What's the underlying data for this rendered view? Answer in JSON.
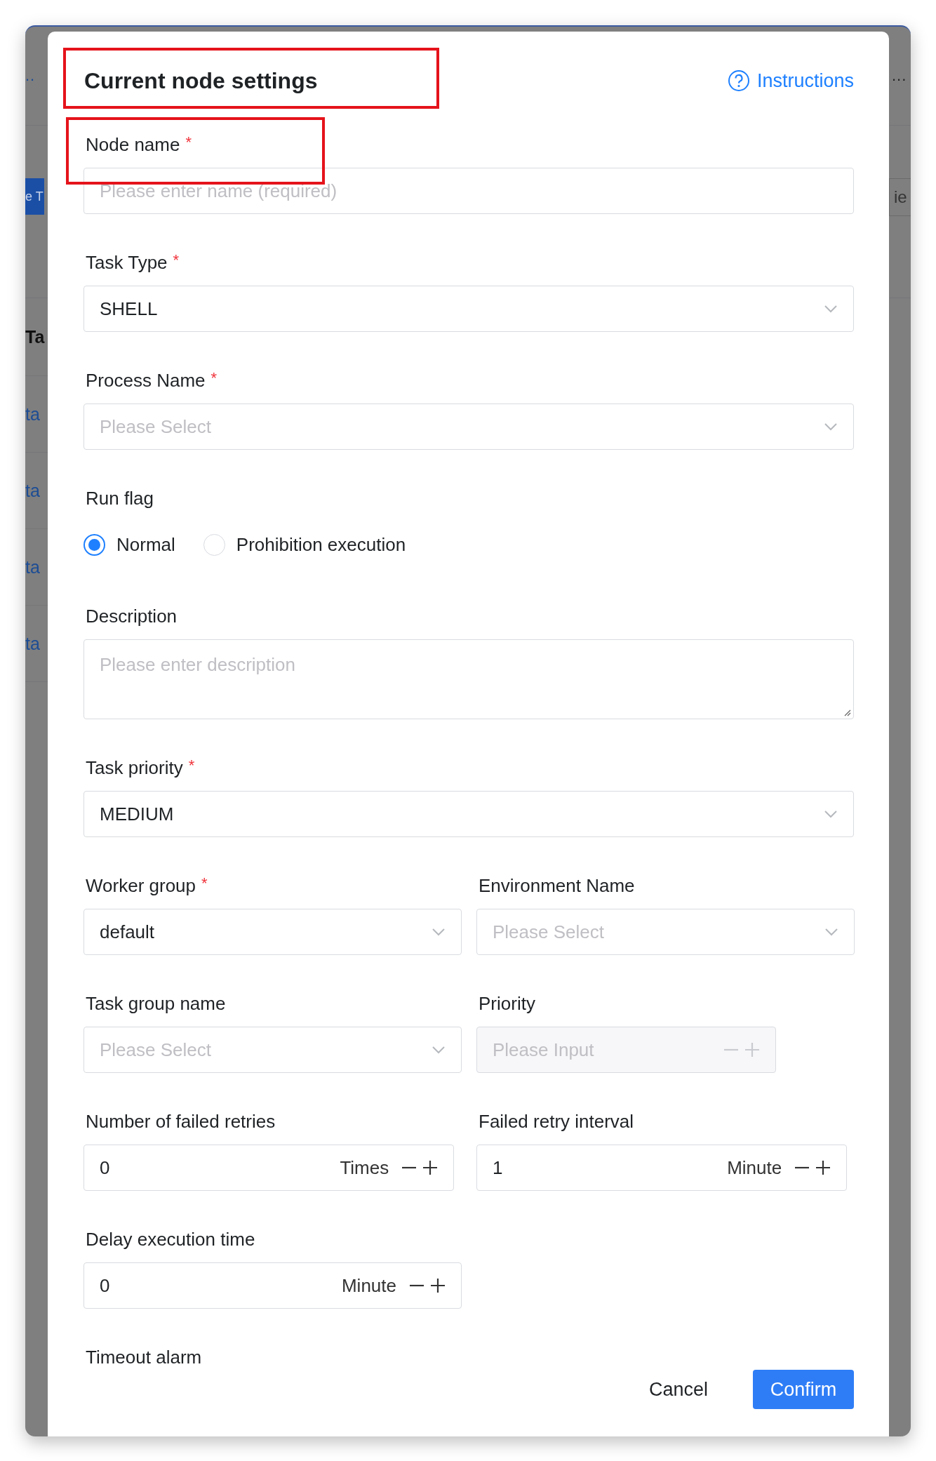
{
  "backdrop": {
    "left": [
      {
        "kind": "dots",
        "text": ".."
      },
      {
        "kind": "button",
        "text": "e T"
      },
      {
        "kind": "header",
        "text": "Ta"
      },
      {
        "kind": "link",
        "text": "ta"
      },
      {
        "kind": "link",
        "text": "ta"
      },
      {
        "kind": "link",
        "text": "ta"
      },
      {
        "kind": "link",
        "text": "ta"
      }
    ],
    "right": [
      {
        "kind": "dots",
        "text": "..."
      },
      {
        "kind": "field",
        "text": "ie"
      }
    ]
  },
  "modal": {
    "title": "Current node settings",
    "help_link": "Instructions",
    "fields": [
      {
        "kind": "input",
        "label": "Node name",
        "required_mark": "*",
        "placeholder": "Please enter name (required)"
      },
      {
        "kind": "select",
        "label": "Task Type",
        "required_mark": "*",
        "value": "SHELL"
      },
      {
        "kind": "select",
        "label": "Process Name",
        "required_mark": "*",
        "placeholder": "Please Select"
      },
      {
        "kind": "radio",
        "label": "Run flag",
        "options": [
          {
            "label": "Normal",
            "selected": true
          },
          {
            "label": "Prohibition execution",
            "selected": false
          }
        ]
      },
      {
        "kind": "textarea",
        "label": "Description",
        "placeholder": "Please enter description"
      },
      {
        "kind": "select",
        "label": "Task priority",
        "required_mark": "*",
        "value": "MEDIUM"
      },
      {
        "kind": "pair",
        "items": [
          {
            "kind": "select",
            "label": "Worker group",
            "required_mark": "*",
            "value": "default"
          },
          {
            "kind": "select",
            "label": "Environment Name",
            "placeholder": "Please Select"
          }
        ]
      },
      {
        "kind": "pair",
        "items": [
          {
            "kind": "select",
            "label": "Task group name",
            "placeholder": "Please Select"
          },
          {
            "kind": "number",
            "label": "Priority",
            "placeholder": "Please Input",
            "disabled": true
          }
        ]
      },
      {
        "kind": "pair",
        "items": [
          {
            "kind": "number",
            "label": "Number of failed retries",
            "value": "0",
            "unit": "Times",
            "disabled": false
          },
          {
            "kind": "number",
            "label": "Failed retry interval",
            "value": "1",
            "unit": "Minute",
            "disabled": false
          }
        ]
      },
      {
        "kind": "number",
        "label": "Delay execution time",
        "value": "0",
        "unit": "Minute",
        "disabled": false
      }
    ],
    "footer_label": "Timeout alarm",
    "buttons": [
      {
        "kind": "secondary",
        "label": "Cancel"
      },
      {
        "kind": "primary",
        "label": "Confirm"
      }
    ]
  }
}
